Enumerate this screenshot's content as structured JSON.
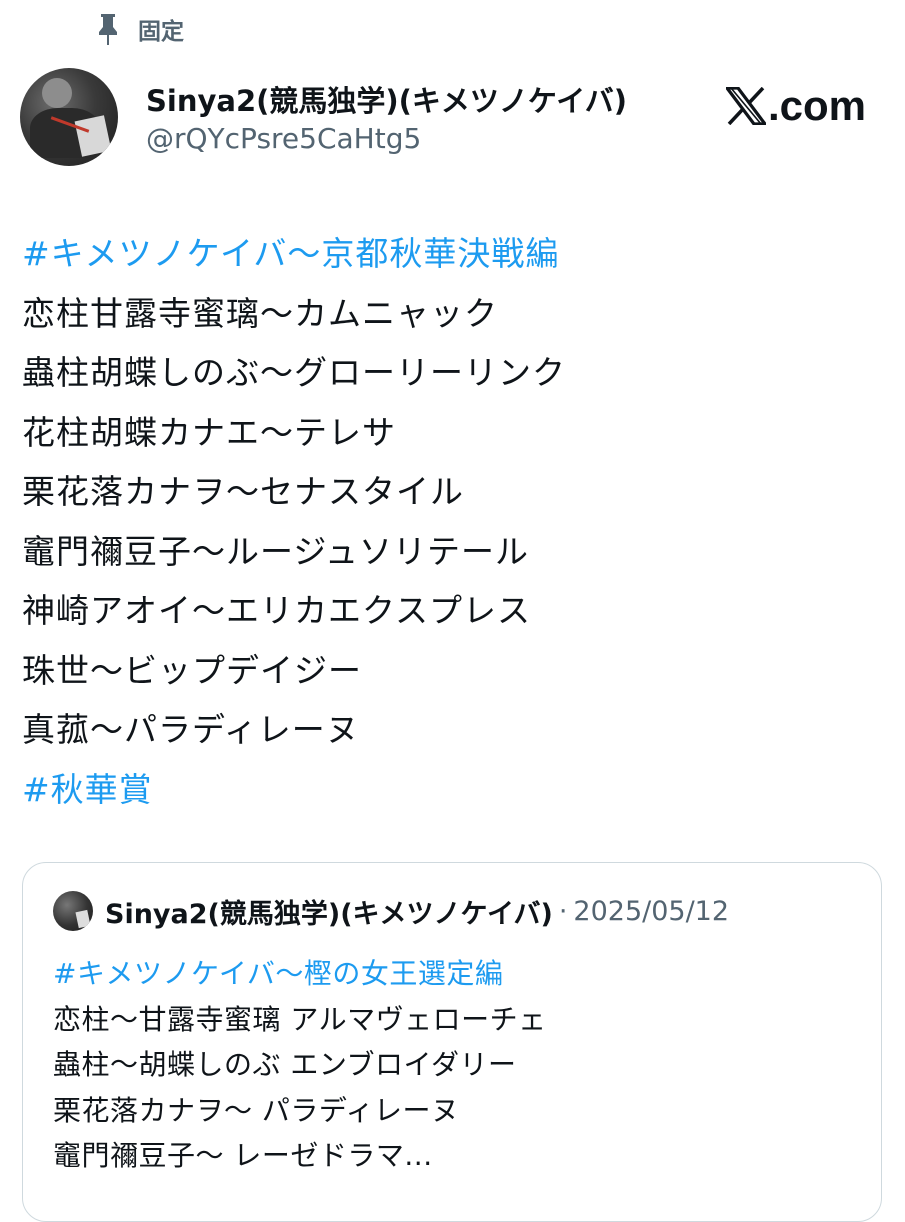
{
  "pinned": {
    "label": "固定"
  },
  "author": {
    "display_name": "Sinya2(競馬独学)(キメツノケイバ)",
    "handle": "@rQYcPsre5CaHtg5"
  },
  "brand": {
    "text": ".com"
  },
  "tweet": {
    "lines": [
      {
        "text": "#キメツノケイバ〜京都秋華決戦編",
        "hashtag": true
      },
      {
        "text": "恋柱甘露寺蜜璃〜カムニャック",
        "hashtag": false
      },
      {
        "text": "蟲柱胡蝶しのぶ〜グローリーリンク",
        "hashtag": false
      },
      {
        "text": "花柱胡蝶カナエ〜テレサ",
        "hashtag": false
      },
      {
        "text": "栗花落カナヲ〜セナスタイル",
        "hashtag": false
      },
      {
        "text": "竈門禰豆子〜ルージュソリテール",
        "hashtag": false
      },
      {
        "text": "神崎アオイ〜エリカエクスプレス",
        "hashtag": false
      },
      {
        "text": "珠世〜ビップデイジー",
        "hashtag": false
      },
      {
        "text": "真菰〜パラディレーヌ",
        "hashtag": false
      },
      {
        "text": "#秋華賞",
        "hashtag": true
      }
    ]
  },
  "quote": {
    "display_name": "Sinya2(競馬独学)(キメツノケイバ)",
    "separator": "·",
    "date": "2025/05/12",
    "lines": [
      {
        "text": "#キメツノケイバ〜樫の女王選定編",
        "hashtag": true
      },
      {
        "text": "恋柱〜甘露寺蜜璃 アルマヴェローチェ",
        "hashtag": false
      },
      {
        "text": "蟲柱〜胡蝶しのぶ エンブロイダリー",
        "hashtag": false
      },
      {
        "text": "栗花落カナヲ〜 パラディレーヌ",
        "hashtag": false
      },
      {
        "text": "竈門禰豆子〜 レーゼドラマ...",
        "hashtag": false
      }
    ]
  },
  "colors": {
    "hashtag": "#1d9bf0",
    "text": "#0f1419",
    "secondary": "#536471",
    "border": "#cfd9de"
  }
}
